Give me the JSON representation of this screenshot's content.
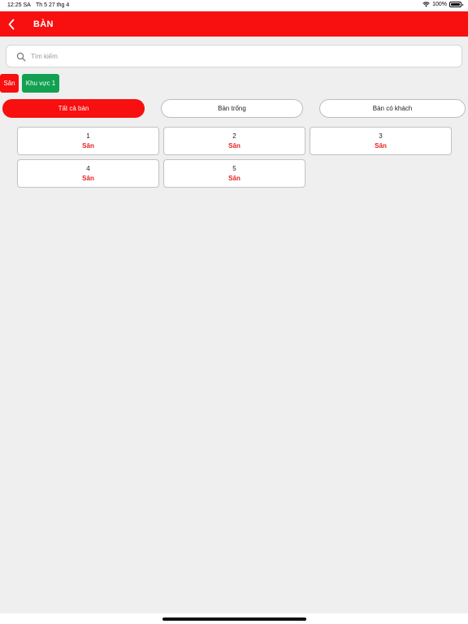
{
  "status_bar": {
    "time": "12:25 SA",
    "date": "Th 5 27 thg 4",
    "battery": "100%"
  },
  "header": {
    "title": "BÀN",
    "back_icon": "chevron-left-icon"
  },
  "search": {
    "placeholder": "Tìm kiếm",
    "value": "",
    "icon": "search-icon"
  },
  "areas": [
    {
      "label": "Sân",
      "color": "#f80f0f",
      "selected": true
    },
    {
      "label": "Khu vực 1",
      "color": "#12a052",
      "selected": false
    }
  ],
  "filters": [
    {
      "label": "Tất cả bàn",
      "active": true
    },
    {
      "label": "Bàn trống",
      "active": false
    },
    {
      "label": "Bàn có khách",
      "active": false
    }
  ],
  "tables": [
    {
      "number": "1",
      "area": "Sân"
    },
    {
      "number": "2",
      "area": "Sân"
    },
    {
      "number": "3",
      "area": "Sân"
    },
    {
      "number": "4",
      "area": "Sân"
    },
    {
      "number": "5",
      "area": "Sân"
    }
  ],
  "colors": {
    "accent": "#f80f0f",
    "area_green": "#12a052",
    "background": "#efefef"
  }
}
